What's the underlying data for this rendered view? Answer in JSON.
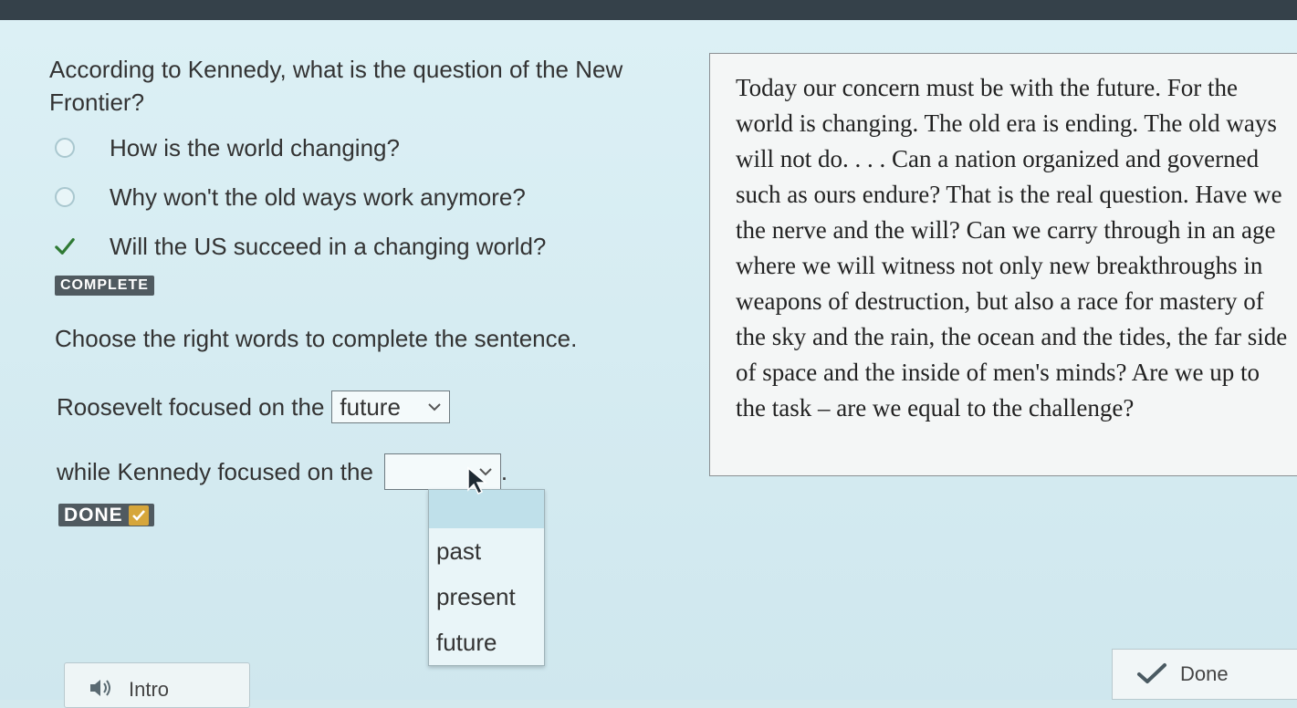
{
  "question": {
    "text": "According to Kennedy, what is the question of the New Frontier?",
    "options": [
      {
        "label": "How is the world changing?",
        "state": "unselected"
      },
      {
        "label": "Why won't the old ways work anymore?",
        "state": "unselected"
      },
      {
        "label": "Will the US succeed in a changing world?",
        "state": "correct"
      }
    ],
    "status_badge": "COMPLETE"
  },
  "sentence_task": {
    "instructions": "Choose the right words to complete the sentence.",
    "line1_prefix": "Roosevelt focused on the",
    "select1_value": "future",
    "line2_prefix": "while Kennedy focused on the",
    "select2_value": "",
    "line2_suffix": ".",
    "dropdown_options": [
      "past",
      "present",
      "future"
    ],
    "done_badge": "DONE"
  },
  "passage": {
    "text": "Today our concern must be with the future. For the world is changing. The old era is ending. The old ways will not do. . . . Can a nation organized and governed such as ours endure? That is the real question. Have we the nerve and the will? Can we carry through in an age where we will witness not only new breakthroughs in weapons of destruction, but also a race for mastery of the sky and the rain, the ocean and the tides, the far side of space and the inside of men's minds? Are we up to the task – are we equal to the challenge?"
  },
  "footer": {
    "intro_label": "Intro",
    "done_label": "Done"
  },
  "colors": {
    "background": "#d3e9ee",
    "check_green": "#2f7a34",
    "badge_gray": "#505a60",
    "done_check_gold": "#d6a63b"
  },
  "icons": [
    "speaker-icon",
    "checkmark-icon",
    "chevron-down-icon",
    "mouse-cursor-icon"
  ]
}
